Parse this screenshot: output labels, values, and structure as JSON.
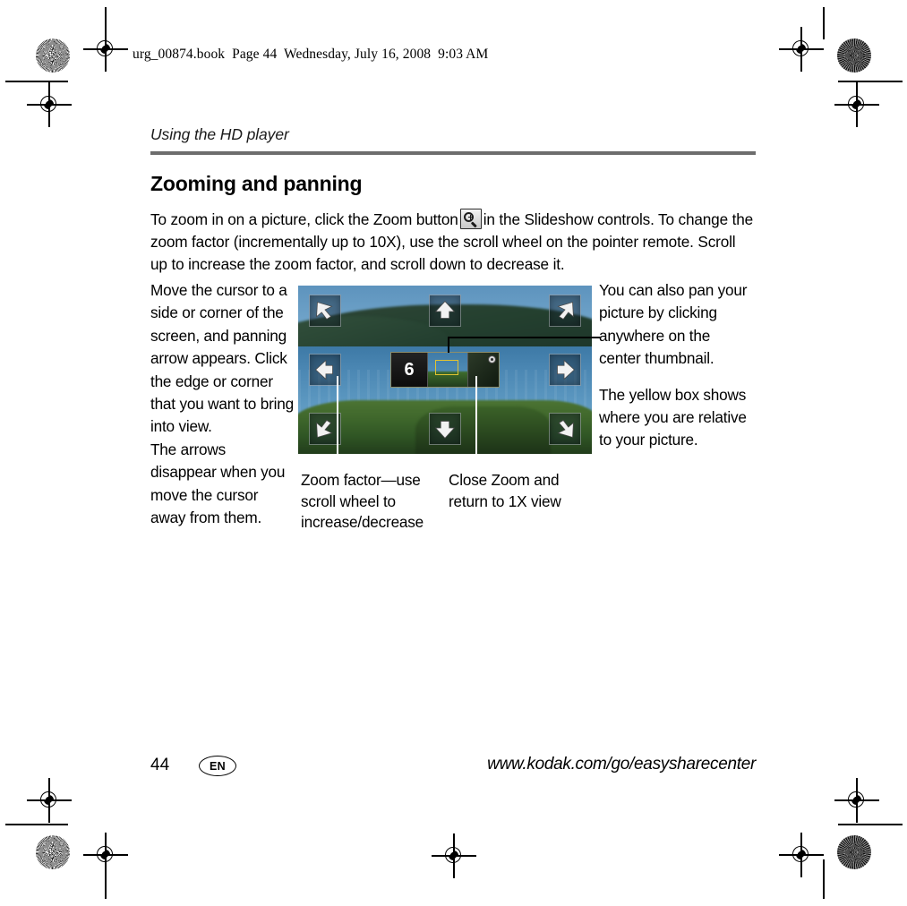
{
  "printers_banner": "urg_00874.book  Page 44  Wednesday, July 16, 2008  9:03 AM",
  "running_head": "Using the HD player",
  "section_title": "Zooming and panning",
  "body": {
    "part1": "To zoom in on a picture, click the Zoom button",
    "icon_name": "zoom-button-icon",
    "part2": "in the Slideshow controls. To change the zoom factor (incrementally up to 10X), use the scroll wheel on the pointer remote. Scroll up to increase the zoom factor, and scroll down to decrease it."
  },
  "figure": {
    "left_column": {
      "paragraph1": "Move the cursor to a side or corner of the screen, and panning arrow appears. Click the edge or corner that you want to bring into view.",
      "paragraph2": "The arrows disappear when you move the cursor away from them."
    },
    "right_column": {
      "paragraph1": "You can also pan your picture by clicking anywhere on the center thumbnail.",
      "paragraph2": "The yellow box shows where you are relative to your picture."
    },
    "captions": {
      "zoom_factor": "Zoom factor—use scroll wheel to increase/decrease",
      "close_zoom": "Close Zoom and return to 1X view"
    },
    "screenshot": {
      "zoom_factor_value": "6",
      "yellow_box_color": "#e2c231",
      "pan_arrows": [
        "pan-arrow-up-left",
        "pan-arrow-up",
        "pan-arrow-up-right",
        "pan-arrow-left",
        "pan-arrow-right",
        "pan-arrow-down-left",
        "pan-arrow-down",
        "pan-arrow-down-right"
      ],
      "close_button_name": "close-zoom-button"
    }
  },
  "footer": {
    "page_number": "44",
    "language": "EN",
    "url": "www.kodak.com/go/easysharecenter"
  }
}
